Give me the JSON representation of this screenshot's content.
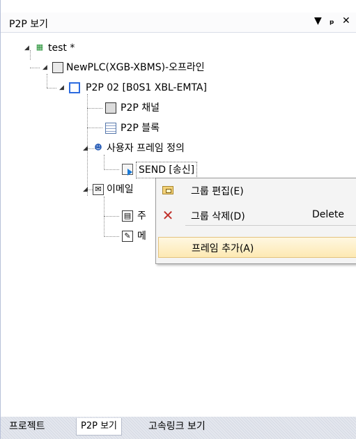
{
  "panel": {
    "title": "P2P 보기",
    "buttons": {
      "dropdown": "▼",
      "pin": "ꟷ",
      "close": "✕"
    }
  },
  "tree": {
    "project": "test *",
    "plc": "NewPLC(XGB-XBMS)-오프라인",
    "p2p": "P2P 02 [B0S1 XBL-EMTA]",
    "channel": "P2P 채널",
    "block": "P2P 블록",
    "user_frame": "사용자 프레임 정의",
    "send": "SEND [송신]",
    "email_partial": "이메일",
    "address_partial": "주",
    "message_partial": "메"
  },
  "context_menu": {
    "items": [
      {
        "label": "그룹 편집(E)",
        "shortcut": "",
        "icon": "folder-icon"
      },
      {
        "label": "그룹 삭제(D)",
        "shortcut": "Delete",
        "icon": "delete-x-icon"
      },
      {
        "label": "프레임 추가(A)",
        "shortcut": "",
        "icon": ""
      }
    ]
  },
  "tabs": [
    {
      "label": "프로젝트"
    },
    {
      "label": "P2P 보기"
    },
    {
      "label": "고속링크 보기"
    }
  ]
}
